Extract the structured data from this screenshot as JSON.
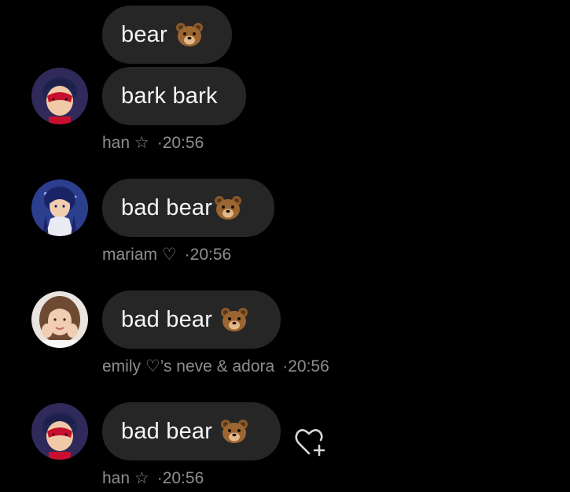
{
  "messages": [
    {
      "text": "bear",
      "emoji": "bear-face-emoji"
    },
    {
      "text": "bark bark",
      "sender": "han ☆",
      "time": "·20:56",
      "avatar": "ladybug-avatar"
    },
    {
      "text": "bad bear",
      "emoji": "bear-face-emoji",
      "sender": "mariam ♡",
      "time": "·20:56",
      "avatar": "dark-haired-girl-avatar"
    },
    {
      "text": "bad bear",
      "emoji": "bear-face-emoji",
      "sender": "emily ♡’s neve & adora",
      "time": "·20:56",
      "avatar": "selfie-photo-avatar"
    },
    {
      "text": "bad bear",
      "emoji": "bear-face-emoji",
      "sender": "han ☆",
      "time": "·20:56",
      "avatar": "ladybug-avatar"
    }
  ],
  "colors": {
    "background": "#000000",
    "bubble": "#262626",
    "meta_text": "#8e8e8e"
  }
}
